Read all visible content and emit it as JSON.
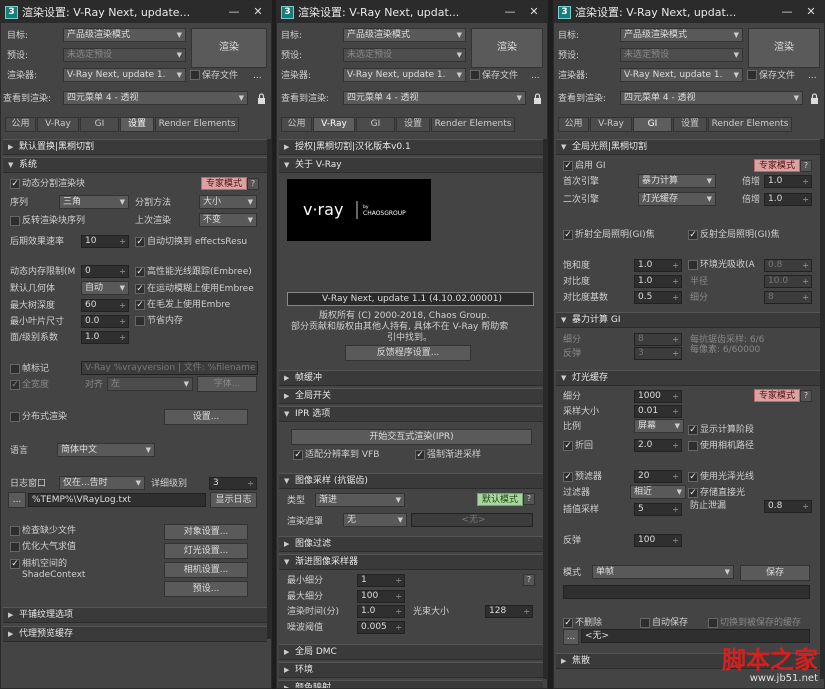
{
  "windows": [
    {
      "title": "渲染设置: V-Ray Next, update..."
    },
    {
      "title": "渲染设置: V-Ray Next, updat..."
    },
    {
      "title": "渲染设置: V-Ray Next, updat..."
    }
  ],
  "common": {
    "target_label": "目标:",
    "target_value": "产品级渲染模式",
    "preset_label": "预设:",
    "preset_value": "未选定预设",
    "renderer_label": "渲染器:",
    "renderer_value": "V-Ray Next, update 1.",
    "save_file": "保存文件",
    "ellipsis": "...",
    "view_label": "查看到渲染:",
    "view_value": "四元菜单 4 - 透视",
    "render_button": "渲染",
    "tabs": [
      "公用",
      "V-Ray",
      "GI",
      "设置",
      "Render Elements"
    ]
  },
  "p1": {
    "sec_default": "默认置换|黑桐切割",
    "sec_system": "系统",
    "dyn_split": "动态分割渲染块",
    "expert": "专家模式",
    "q": "?",
    "sequence_label": "序列",
    "sequence_value": "三角",
    "split_label": "分割方法",
    "split_value": "大小",
    "reverse": "反转渲染块序列",
    "last_label": "上次渲染",
    "last_value": "不变",
    "post_label": "后期效果速率",
    "post_value": "10",
    "auto_switch": "自动切换到 effectsResu",
    "dyn_mem_label": "动态内存限制(M",
    "dyn_mem_value": "0",
    "hp_ray": "高性能光线跟踪(Embree)",
    "default_geo_label": "默认几何体",
    "default_geo_value": "自动",
    "motion_blur": "在运动模糊上使用Embree",
    "tree_label": "最大树深度",
    "tree_value": "60",
    "hair": "在毛发上使用Embre",
    "leaf_label": "最小叶片尺寸",
    "leaf_value": "0.0",
    "save_mem": "节省内存",
    "face_label": "面/级别系数",
    "face_value": "1.0",
    "frame_stamp": "帧标记",
    "stamp_text": "V-Ray %vrayversion | 文件: %filename",
    "full_width": "全宽度",
    "align_label": "对齐",
    "align_value": "左",
    "font_btn": "字体...",
    "distributed": "分布式渲染",
    "settings_btn": "设置...",
    "lang_label": "语言",
    "lang_value": "简体中文",
    "log_label": "日志窗口",
    "log_value": "仅在...告时",
    "detail_label": "详细级别",
    "detail_value": "3",
    "log_path": "%TEMP%\\VRayLog.txt",
    "show_log": "显示日志",
    "check_missing": "检查缺少文件",
    "opt_atmo": "优化大气求值",
    "camera_space": "相机空间的",
    "shade_ctx": "ShadeContext",
    "obj_btn": "对象设置...",
    "light_btn": "灯光设置...",
    "cam_btn": "相机设置...",
    "preset_btn": "预设...",
    "sec_tile": "平铺纹理选项",
    "sec_proxy": "代理预览缓存"
  },
  "p2": {
    "sec_auth": "授权|黑桐切割|汉化版本v0.1",
    "sec_about": "关于 V-Ray",
    "logo_text": "v·ray",
    "logo_sub": "by CHAOSGROUP",
    "version": "V-Ray Next, update 1.1 (4.10.02.00001)",
    "copyright1": "版权所有 (C) 2000-2018, Chaos Group.",
    "copyright2": "部分贡献和版权由其他人持有, 具体不在 V-Ray 帮助索",
    "copyright3": "引中找到。",
    "feedback_btn": "反馈程序设置...",
    "sec_frame": "帧缓冲",
    "sec_global": "全局开关",
    "sec_ipr": "IPR 选项",
    "ipr_btn": "开始交互式渲染(IPR)",
    "fit_vfb": "适配分辨率到 VFB",
    "force_prog": "强制渐进采样",
    "sec_img": "图像采样 (抗锯齿)",
    "type_label": "类型",
    "type_value": "渐进",
    "default_mode": "默认模式",
    "mask_label": "渲染遮罩",
    "mask_value": "无",
    "mask_none": "<无>",
    "sec_filter": "图像过滤",
    "sec_prog": "渐进图像采样器",
    "min_label": "最小细分",
    "min_value": "1",
    "max_label": "最大细分",
    "max_value": "100",
    "time_label": "渲染时间(分)",
    "time_value": "1.0",
    "bundle_label": "光束大小",
    "bundle_value": "128",
    "noise_label": "噪波阈值",
    "noise_value": "0.005",
    "sec_dmc": "全局 DMC",
    "sec_env": "环境",
    "sec_color": "颜色映射"
  },
  "p3": {
    "sec_gi": "全局光照|黑桐切割",
    "enable_gi": "启用 GI",
    "expert": "专家模式",
    "q": "?",
    "primary_label": "首次引擎",
    "primary_value": "暴力计算",
    "mult_label": "倍增",
    "mult1": "1.0",
    "secondary_label": "二次引擎",
    "secondary_value": "灯光缓存",
    "mult2": "1.0",
    "refr_caustics": "折射全局照明(GI)焦",
    "refl_caustics": "反射全局照明(GI)焦",
    "sat_label": "饱和度",
    "sat_value": "1.0",
    "ao": "环境光吸收(A",
    "ao_value": "0.8",
    "contrast_label": "对比度",
    "contrast_value": "1.0",
    "radius_label": "半径",
    "radius_value": "10.0",
    "base_label": "对比度基数",
    "base_value": "0.5",
    "sub_label": "细分",
    "sub_value": "8",
    "sec_bf": "暴力计算 GI",
    "bf_sub_label": "细分",
    "bf_sub_value": "8",
    "bf_aa": "每抗锯齿采样: 6/6",
    "bf_bounce_label": "反弹",
    "bf_bounce_value": "3",
    "bf_px": "每像素: 6/60000",
    "sec_lc": "灯光缓存",
    "lc_sub_label": "细分",
    "lc_sub_value": "1000",
    "sample_label": "采样大小",
    "sample_value": "0.01",
    "scale_label": "比例",
    "scale_value": "屏幕",
    "show_calc": "显示计算阶段",
    "retrace": "折回",
    "retrace_value": "2.0",
    "use_cam": "使用相机路径",
    "prefilter": "预滤器",
    "prefilter_value": "20",
    "use_light": "使用光泽光线",
    "filter_label": "过滤器",
    "filter_value": "相近",
    "store_direct": "存储直接光",
    "interp_label": "插值采样",
    "interp_value": "5",
    "leak_label": "防止泄漏",
    "leak_value": "0.8",
    "bounce_label": "反弹",
    "bounce_value": "100",
    "mode_label": "模式",
    "mode_value": "单帧",
    "save_btn": "保存",
    "no_delete": "不删除",
    "auto_save": "自动保存",
    "switch_saved": "切换到被保存的缓存",
    "none_value": "<无>",
    "sec_caustics": "焦散"
  },
  "watermark": {
    "main": "脚本之家",
    "url": "www.jb51.net"
  }
}
